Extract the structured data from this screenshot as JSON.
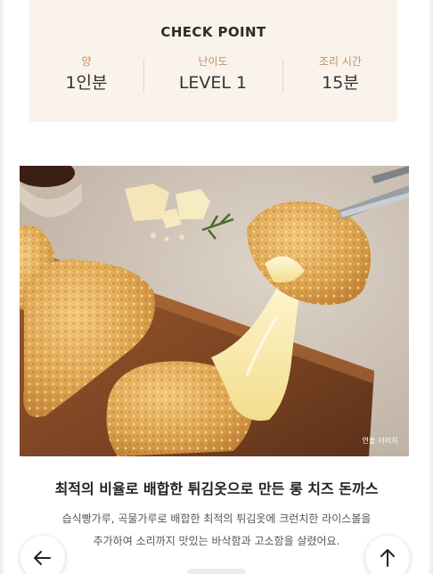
{
  "checkpoint": {
    "title": "CHECK POINT",
    "items": [
      {
        "label": "양",
        "value": "1인분"
      },
      {
        "label": "난이도",
        "value": "LEVEL 1"
      },
      {
        "label": "조리 시간",
        "value": "15분"
      }
    ]
  },
  "photo": {
    "caption": "연출 이미지"
  },
  "product": {
    "headline": "최적의 비율로 배합한 튀김옷으로 만든 롱 치즈 돈까스",
    "description_line1": "습식빵가루, 곡물가루로 배합한 최적의 튀김옷에 크런치한 라이스볼을",
    "description_line2": "추가하여 소리까지 맛있는 바삭함과 고소함을 살렸어요."
  },
  "navigation": {
    "back_icon": "arrow-left-icon",
    "top_icon": "arrow-up-icon"
  },
  "colors": {
    "checkpoint_bg": "#faf3ec",
    "label_accent": "#c49068"
  }
}
